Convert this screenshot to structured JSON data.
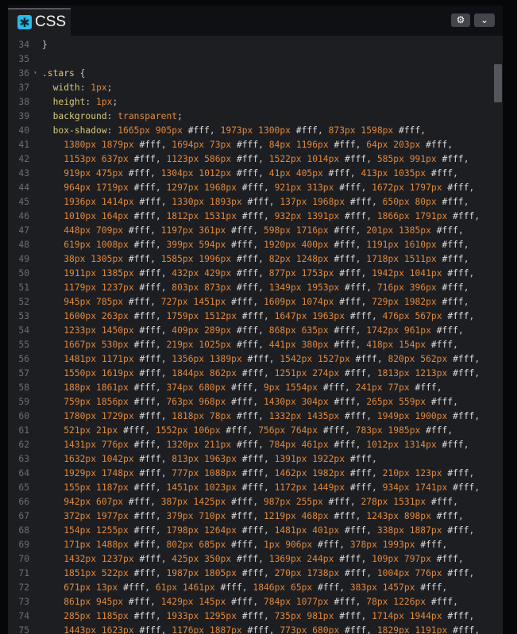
{
  "tab": {
    "title": "CSS",
    "icon": "css-asterisk-icon",
    "icon_glyph": "✱"
  },
  "header": {
    "settings_icon": "gear-icon",
    "settings_glyph": "⚙",
    "collapse_icon": "chevron-down-icon",
    "collapse_glyph": "⌄"
  },
  "colors": {
    "background": "#1d1e22",
    "header": "#0f1013",
    "accent": "#2bb8ea",
    "number": "#e0893c",
    "selector": "#e8c07d",
    "property": "#d5c87a",
    "line_number": "#6d6e74"
  },
  "editor": {
    "lines": [
      {
        "n": "34",
        "text": "}"
      },
      {
        "n": "35",
        "text": ""
      },
      {
        "n": "36",
        "fold": "▾",
        "text": ".stars {"
      },
      {
        "n": "37",
        "text": "  width: 1px;"
      },
      {
        "n": "38",
        "text": "  height: 1px;"
      },
      {
        "n": "39",
        "text": "  background: transparent;"
      },
      {
        "n": "40",
        "text": "  box-shadow: 1665px 905px #fff, 1973px 1300px #fff, 873px 1598px #fff,"
      },
      {
        "n": "41",
        "text": "    1380px 1879px #fff, 1694px 73px #fff, 84px 1196px #fff, 64px 203px #fff,"
      },
      {
        "n": "42",
        "text": "    1153px 637px #fff, 1123px 586px #fff, 1522px 1014px #fff, 585px 991px #fff,"
      },
      {
        "n": "43",
        "text": "    919px 475px #fff, 1304px 1012px #fff, 41px 405px #fff, 413px 1035px #fff,"
      },
      {
        "n": "44",
        "text": "    964px 1719px #fff, 1297px 1968px #fff, 921px 313px #fff, 1672px 1797px #fff,"
      },
      {
        "n": "45",
        "text": "    1936px 1414px #fff, 1330px 1893px #fff, 137px 1968px #fff, 650px 80px #fff,"
      },
      {
        "n": "46",
        "text": "    1010px 164px #fff, 1812px 1531px #fff, 932px 1391px #fff, 1866px 1791px #fff,"
      },
      {
        "n": "47",
        "text": "    448px 709px #fff, 1197px 361px #fff, 598px 1716px #fff, 201px 1385px #fff,"
      },
      {
        "n": "48",
        "text": "    619px 1008px #fff, 399px 594px #fff, 1920px 400px #fff, 1191px 1610px #fff,"
      },
      {
        "n": "49",
        "text": "    38px 1305px #fff, 1585px 1996px #fff, 82px 1248px #fff, 1718px 1511px #fff,"
      },
      {
        "n": "50",
        "text": "    1911px 1385px #fff, 432px 429px #fff, 877px 1753px #fff, 1942px 1041px #fff,"
      },
      {
        "n": "51",
        "text": "    1179px 1237px #fff, 803px 873px #fff, 1349px 1953px #fff, 716px 396px #fff,"
      },
      {
        "n": "52",
        "text": "    945px 785px #fff, 727px 1451px #fff, 1609px 1074px #fff, 729px 1982px #fff,"
      },
      {
        "n": "53",
        "text": "    1600px 263px #fff, 1759px 1512px #fff, 1647px 1963px #fff, 476px 567px #fff,"
      },
      {
        "n": "54",
        "text": "    1233px 1450px #fff, 409px 289px #fff, 868px 635px #fff, 1742px 961px #fff,"
      },
      {
        "n": "55",
        "text": "    1667px 530px #fff, 219px 1025px #fff, 441px 380px #fff, 418px 154px #fff,"
      },
      {
        "n": "56",
        "text": "    1481px 1171px #fff, 1356px 1389px #fff, 1542px 1527px #fff, 820px 562px #fff,"
      },
      {
        "n": "57",
        "text": "    1550px 1619px #fff, 1844px 862px #fff, 1251px 274px #fff, 1813px 1213px #fff,"
      },
      {
        "n": "58",
        "text": "    188px 1861px #fff, 374px 680px #fff, 9px 1554px #fff, 241px 77px #fff,"
      },
      {
        "n": "59",
        "text": "    759px 1856px #fff, 763px 968px #fff, 1430px 304px #fff, 265px 559px #fff,"
      },
      {
        "n": "60",
        "text": "    1780px 1729px #fff, 1818px 78px #fff, 1332px 1435px #fff, 1949px 1900px #fff,"
      },
      {
        "n": "61",
        "text": "    521px 21px #fff, 1552px 106px #fff, 756px 764px #fff, 783px 1985px #fff,"
      },
      {
        "n": "62",
        "text": "    1431px 776px #fff, 1320px 211px #fff, 784px 461px #fff, 1012px 1314px #fff,"
      },
      {
        "n": "63",
        "text": "    1632px 1042px #fff, 813px 1963px #fff, 1391px 1922px #fff,"
      },
      {
        "n": "64",
        "text": "    1929px 1748px #fff, 777px 1088px #fff, 1462px 1982px #fff, 210px 123px #fff,"
      },
      {
        "n": "65",
        "text": "    155px 1187px #fff, 1451px 1023px #fff, 1172px 1449px #fff, 934px 1741px #fff,"
      },
      {
        "n": "66",
        "text": "    942px 607px #fff, 387px 1425px #fff, 987px 255px #fff, 278px 1531px #fff,"
      },
      {
        "n": "67",
        "text": "    372px 1977px #fff, 379px 710px #fff, 1219px 468px #fff, 1243px 898px #fff,"
      },
      {
        "n": "68",
        "text": "    154px 1255px #fff, 1798px 1264px #fff, 1481px 401px #fff, 338px 1887px #fff,"
      },
      {
        "n": "69",
        "text": "    171px 1488px #fff, 802px 685px #fff, 1px 906px #fff, 378px 1993px #fff,"
      },
      {
        "n": "70",
        "text": "    1432px 1237px #fff, 425px 350px #fff, 1369px 244px #fff, 109px 797px #fff,"
      },
      {
        "n": "71",
        "text": "    1851px 522px #fff, 1987px 1805px #fff, 270px 1738px #fff, 1004px 776px #fff,"
      },
      {
        "n": "72",
        "text": "    671px 13px #fff, 61px 1461px #fff, 1846px 65px #fff, 383px 1457px #fff,"
      },
      {
        "n": "73",
        "text": "    861px 945px #fff, 1429px 145px #fff, 784px 1077px #fff, 78px 1226px #fff,"
      },
      {
        "n": "74",
        "text": "    285px 1185px #fff, 1933px 1295px #fff, 735px 981px #fff, 1714px 1944px #fff,"
      },
      {
        "n": "75",
        "text": "    1443px 1623px #fff, 1176px 1887px #fff, 773px 680px #fff, 1829px 1191px #fff,"
      }
    ]
  }
}
